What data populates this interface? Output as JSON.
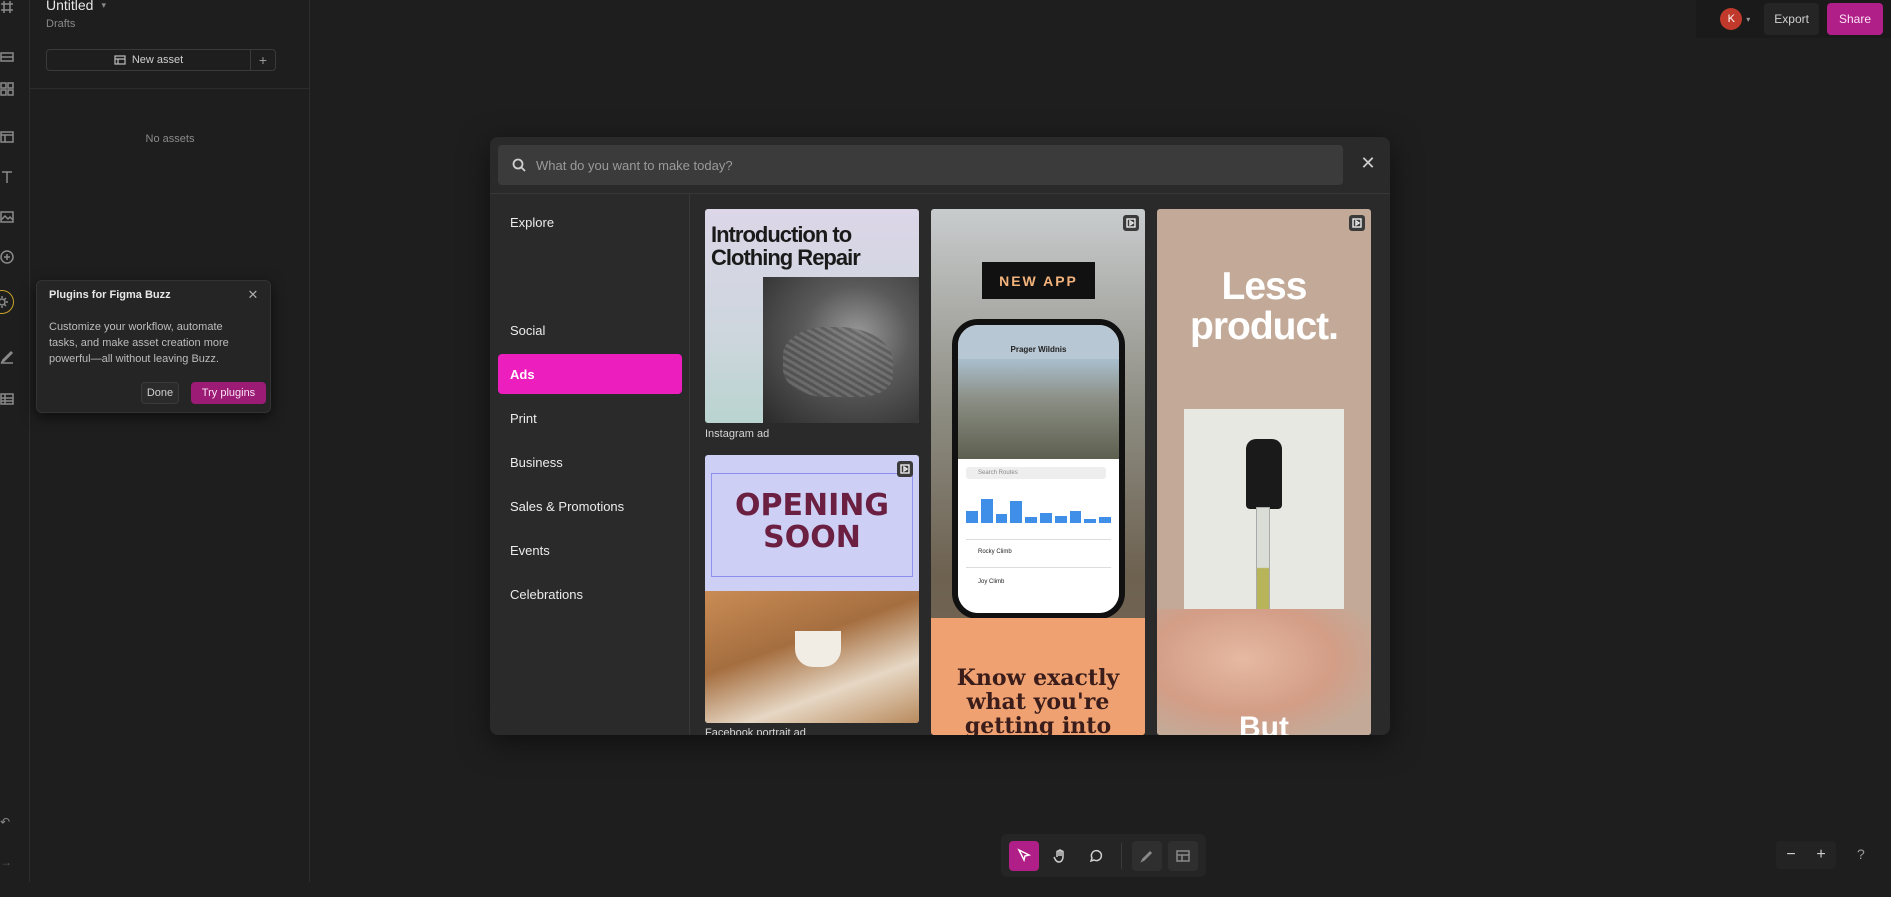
{
  "file": {
    "title": "Untitled",
    "location": "Drafts"
  },
  "assets_panel": {
    "new_asset_label": "New asset",
    "add_symbol": "+",
    "empty_label": "No assets"
  },
  "plugins_popup": {
    "title": "Plugins for Figma Buzz",
    "body": "Customize your workflow, automate tasks, and make asset creation more powerful—all without leaving Buzz.",
    "done_label": "Done",
    "try_label": "Try plugins"
  },
  "header": {
    "avatar_initial": "K",
    "export_label": "Export",
    "share_label": "Share"
  },
  "modal": {
    "search_placeholder": "What do you want to make today?",
    "categories": [
      {
        "label": "Explore"
      },
      {
        "label": "Social"
      },
      {
        "label": "Ads",
        "active": true
      },
      {
        "label": "Print"
      },
      {
        "label": "Business"
      },
      {
        "label": "Sales & Promotions"
      },
      {
        "label": "Events"
      },
      {
        "label": "Celebrations"
      }
    ],
    "templates": [
      {
        "label": "Instagram ad",
        "headline": "Introduction to Clothing Repair"
      },
      {
        "label": "",
        "headline": "NEW APP",
        "phone_title": "Prager Wildnis",
        "phone_search": "Search Routes",
        "phone_rows": [
          "Rocky Climb",
          "Joy Climb"
        ],
        "footer": "Know exactly what you're getting into"
      },
      {
        "label": "",
        "headline": "Less product.",
        "footer": "But"
      },
      {
        "label": "Facebook portrait ad",
        "headline": "OPENING SOON"
      }
    ]
  },
  "toolbar": {
    "tools": [
      "move-tool",
      "hand-tool",
      "comment-tool",
      "draw-tool",
      "layout-tool"
    ]
  },
  "zoom": {
    "minus": "−",
    "plus": "+"
  },
  "help_label": "?",
  "colors": {
    "accent": "#ec1ebe",
    "share": "#b01e88",
    "background": "#1e1e1e"
  }
}
